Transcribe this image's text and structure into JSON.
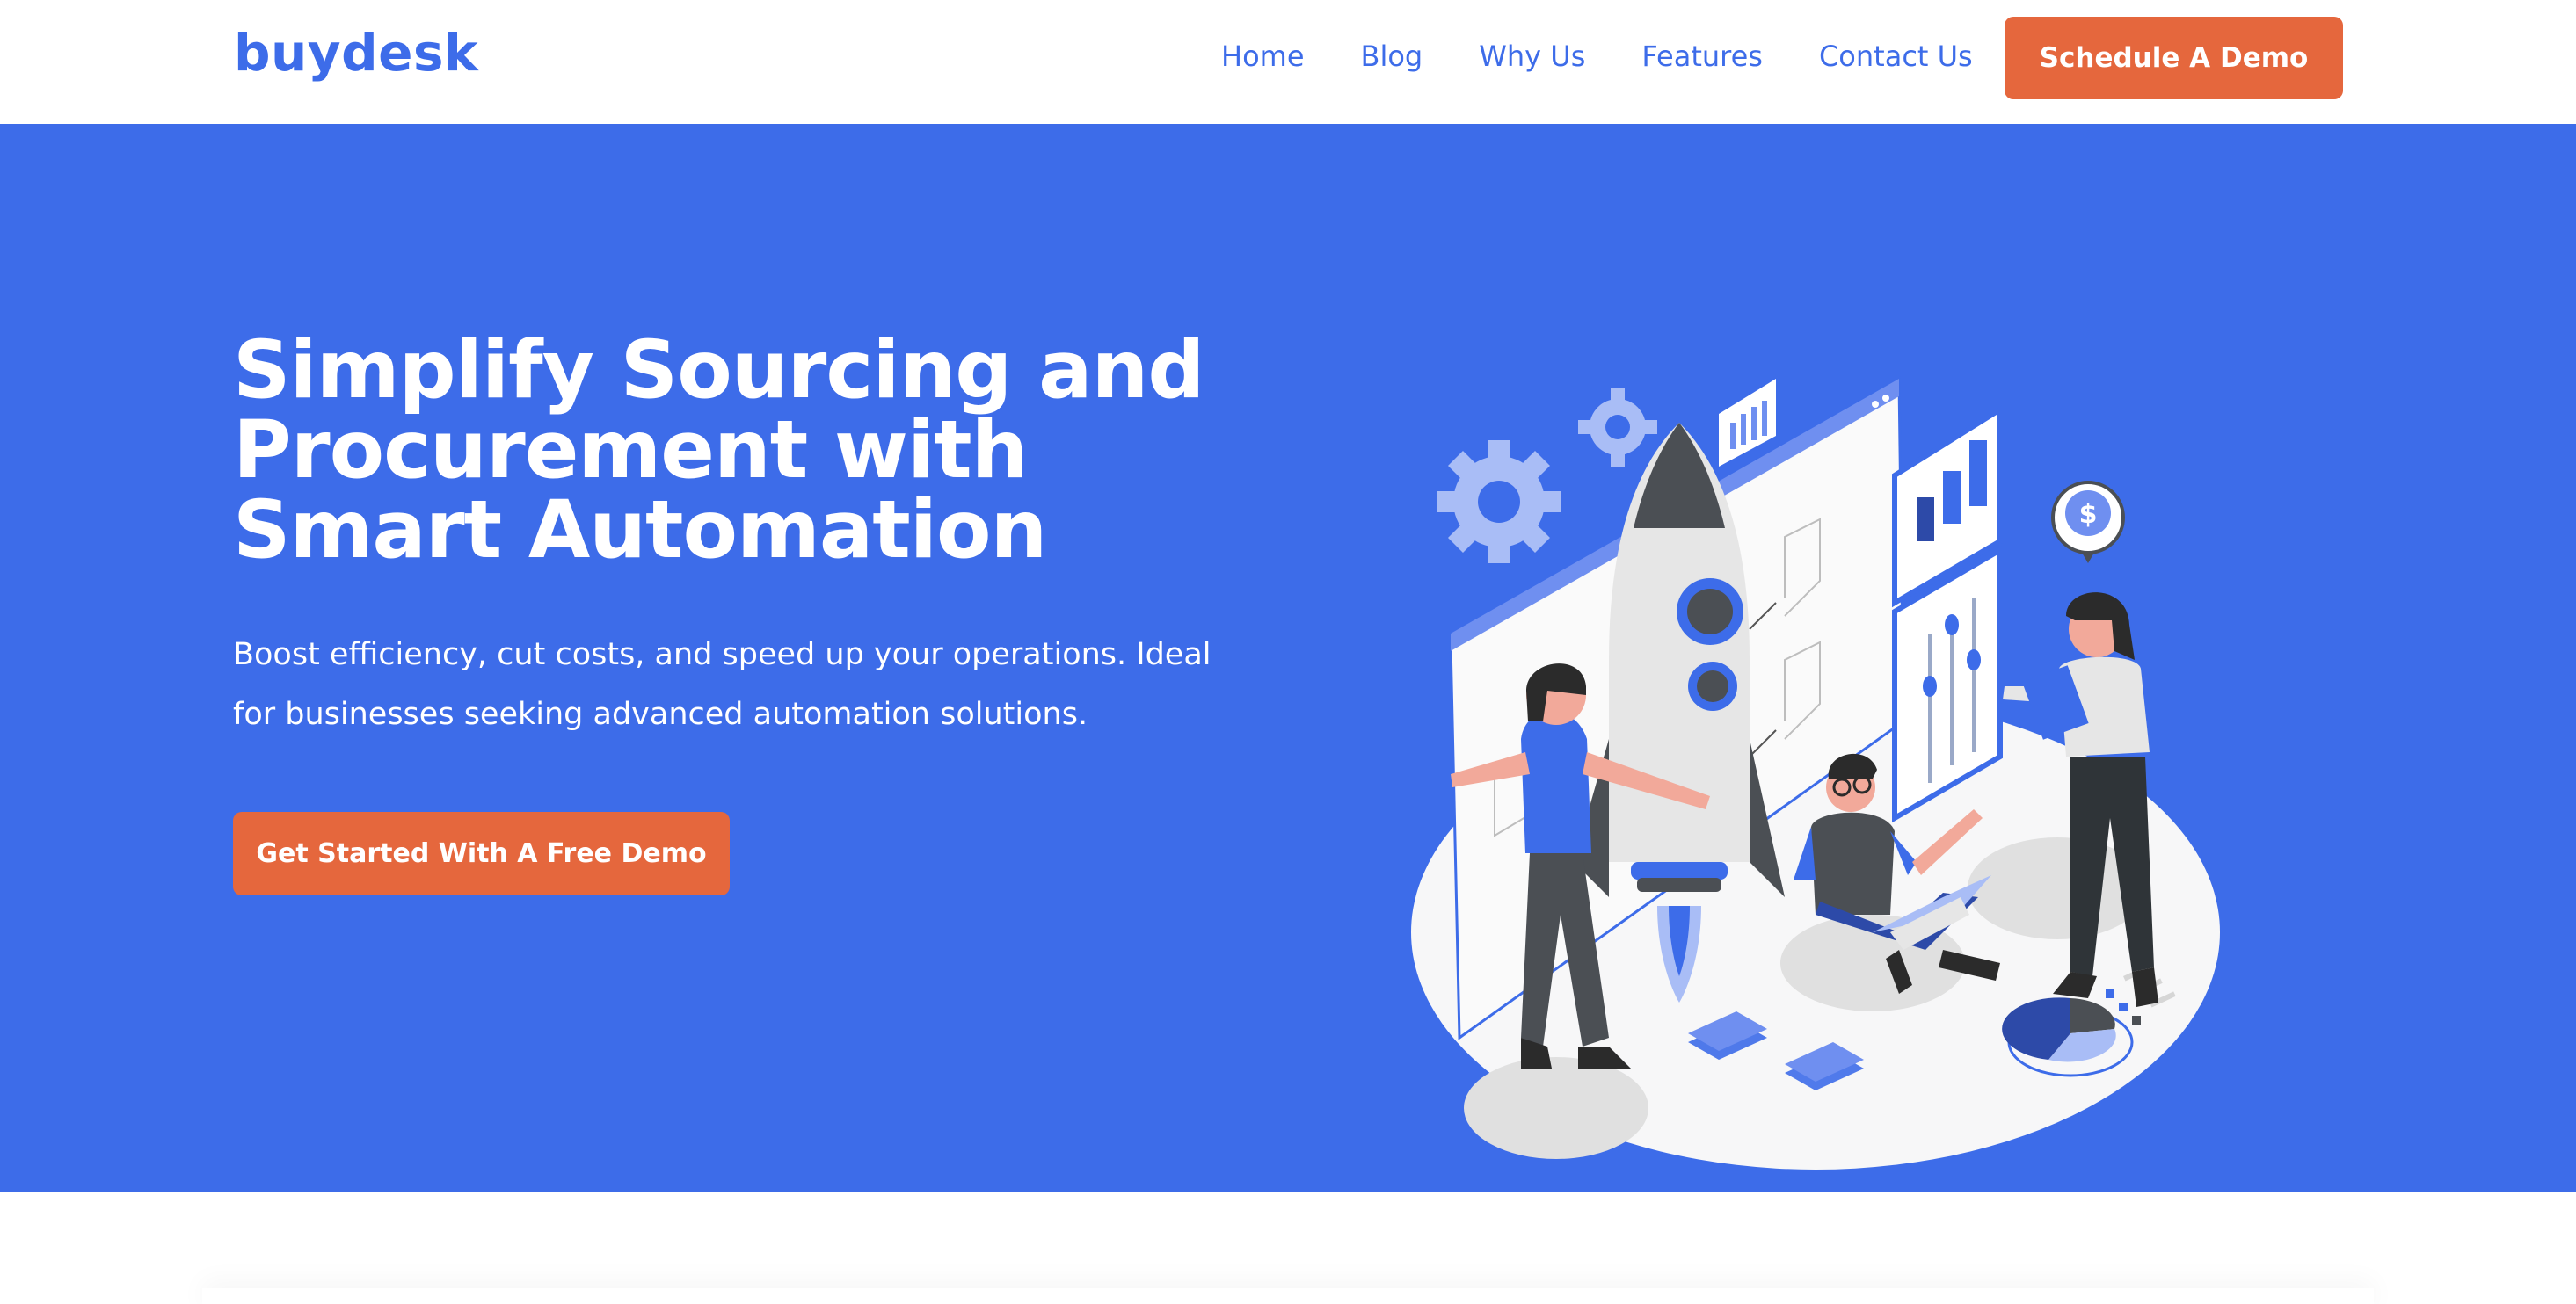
{
  "brand": {
    "logo": "buydesk",
    "accent": "#3d6ce9",
    "cta_color": "#e5673d"
  },
  "nav": {
    "items": [
      {
        "label": "Home"
      },
      {
        "label": "Blog"
      },
      {
        "label": "Why Us"
      },
      {
        "label": "Features"
      },
      {
        "label": "Contact Us"
      }
    ],
    "cta_label": "Schedule A Demo"
  },
  "hero": {
    "title": "Simplify Sourcing and Procurement with Smart Automation",
    "subtitle": "Boost efficiency, cut costs, and speed up your operations. Ideal for businesses seeking advanced automation solutions.",
    "cta_label": "Get Started With A Free Demo",
    "illustration_icon": "team-rocket-automation-illustration"
  }
}
